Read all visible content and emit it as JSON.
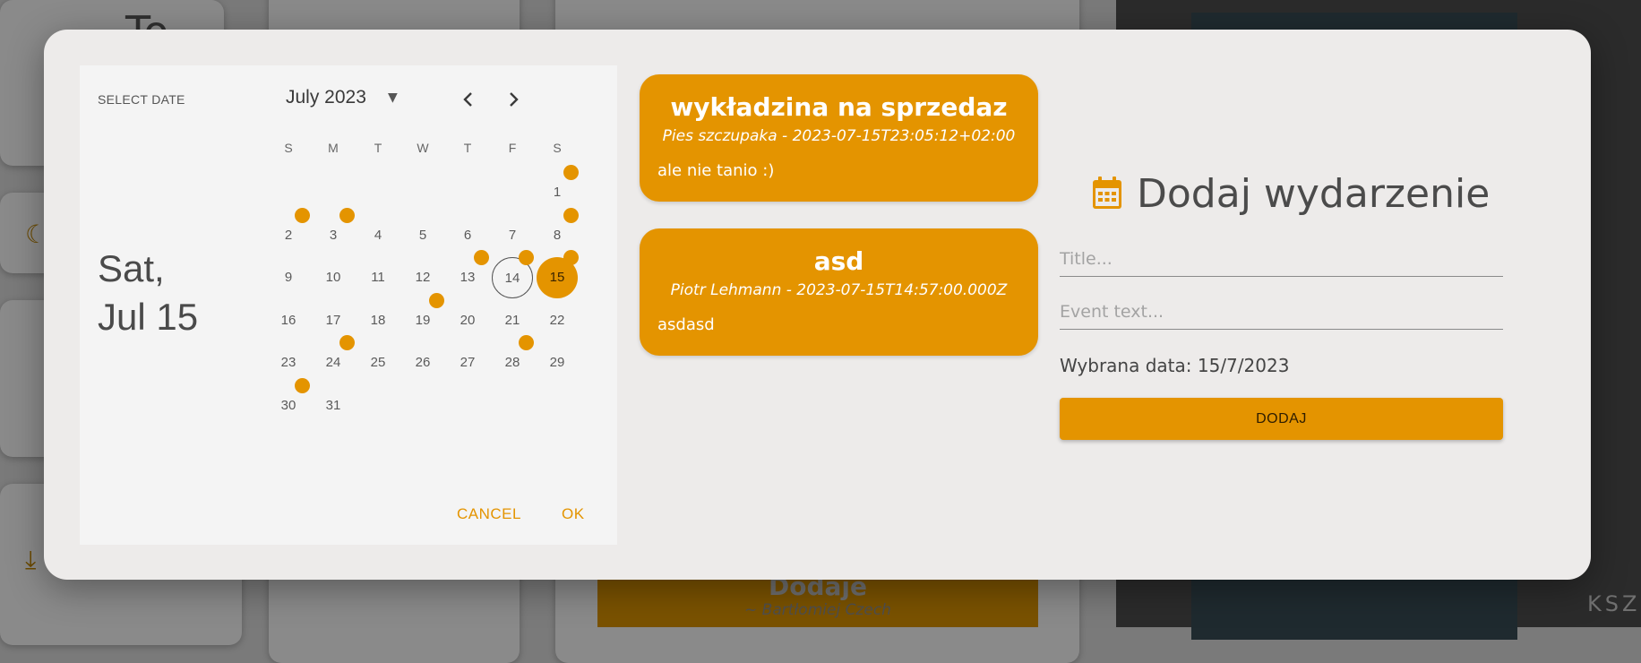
{
  "background": {
    "heading_fragment": "To",
    "card_title": "Dodaje",
    "card_author": "~ Bartłomiej Czech",
    "watermark": "KSZ"
  },
  "picker": {
    "select_date_label": "SELECT DATE",
    "selected_date_line1": "Sat,",
    "selected_date_line2": "Jul 15",
    "month_label": "July 2023",
    "weekdays": [
      "S",
      "M",
      "T",
      "W",
      "T",
      "F",
      "S"
    ],
    "days": [
      "1",
      "2",
      "3",
      "4",
      "5",
      "6",
      "7",
      "8",
      "9",
      "10",
      "11",
      "12",
      "13",
      "14",
      "15",
      "16",
      "17",
      "18",
      "19",
      "20",
      "21",
      "22",
      "23",
      "24",
      "25",
      "26",
      "27",
      "28",
      "29",
      "30",
      "31"
    ],
    "first_weekday_index": 6,
    "today": "14",
    "selected": "15",
    "event_days": [
      "1",
      "2",
      "3",
      "8",
      "13",
      "14",
      "15",
      "19",
      "24",
      "28",
      "30"
    ],
    "cancel_label": "CANCEL",
    "ok_label": "OK"
  },
  "events": [
    {
      "title": "wykładzina na sprzedaz",
      "meta": "Pies szczupaka - 2023-07-15T23:05:12+02:00",
      "body": "ale nie tanio :)"
    },
    {
      "title": "asd",
      "meta": "Piotr Lehmann - 2023-07-15T14:57:00.000Z",
      "body": "asdasd"
    }
  ],
  "form": {
    "title": "Dodaj wydarzenie",
    "title_placeholder": "Title...",
    "text_placeholder": "Event text...",
    "selected_date_text": "Wybrana data: 15/7/2023",
    "submit_label": "DODAJ"
  },
  "colors": {
    "accent": "#e49400",
    "modal_bg": "#edebea",
    "picker_bg": "#f4f4f4"
  }
}
